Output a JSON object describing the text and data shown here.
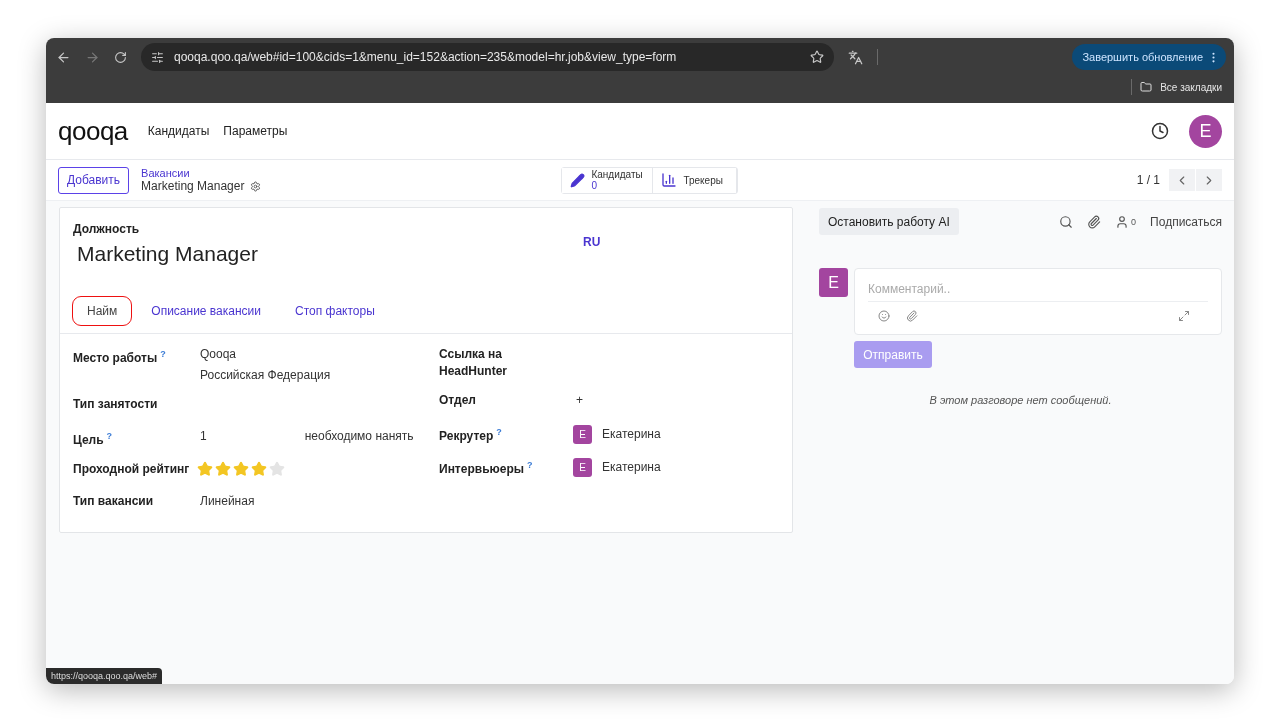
{
  "browser": {
    "url": "qooqa.qoo.qa/web#id=100&cids=1&menu_id=152&action=235&model=hr.job&view_type=form",
    "update_button": "Завершить обновление",
    "bookmarks_label": "Все закладки"
  },
  "navbar": {
    "logo": "qooqa",
    "menu": [
      "Кандидаты",
      "Параметры"
    ],
    "avatar_initial": "E"
  },
  "control_panel": {
    "add_button": "Добавить",
    "breadcrumb": "Вакансии",
    "record_title": "Marketing Manager",
    "smart_buttons": [
      {
        "kind": "candidates",
        "label": "Кандидаты",
        "count": "0"
      },
      {
        "kind": "trackers",
        "label": "Трекеры"
      }
    ],
    "pager": "1 / 1"
  },
  "form": {
    "title_label": "Должность",
    "title": "Marketing Manager",
    "lang": "RU",
    "tabs": [
      {
        "label": "Найм",
        "selected": true
      },
      {
        "label": "Описание вакансии",
        "selected": false
      },
      {
        "label": "Стоп факторы",
        "selected": false
      }
    ],
    "left_fields": [
      {
        "kind": "text",
        "label": "Место работы",
        "help": "?",
        "values": [
          "Qooqa",
          "Российская Федерация"
        ]
      },
      {
        "kind": "empty",
        "label": "Тип занятости"
      },
      {
        "kind": "target",
        "label": "Цель",
        "help": "?",
        "value": "1",
        "suffix": "необходимо нанять"
      },
      {
        "kind": "stars",
        "label": "Проходной рейтинг",
        "stars": 4
      },
      {
        "kind": "text",
        "label": "Тип вакансии",
        "values": [
          "Линейная"
        ]
      }
    ],
    "right_fields": [
      {
        "kind": "empty",
        "label": "Ссылка на HeadHunter"
      },
      {
        "kind": "add",
        "label": "Отдел",
        "value": "+"
      },
      {
        "kind": "user",
        "label": "Рекрутер",
        "help": "?",
        "initial": "E",
        "value": "Екатерина"
      },
      {
        "kind": "user",
        "label": "Интервьюеры",
        "help": "?",
        "initial": "E",
        "value": "Екатерина"
      }
    ]
  },
  "chatter": {
    "ai_button": "Остановить работу AI",
    "follower_count": "0",
    "follow_label": "Подписаться",
    "avatar_initial": "E",
    "comment_placeholder": "Комментарий..",
    "send_button": "Отправить",
    "empty_message": "В этом разговоре нет сообщений."
  },
  "status_bar": {
    "url": "https://qooqa.qoo.qa/web#"
  }
}
